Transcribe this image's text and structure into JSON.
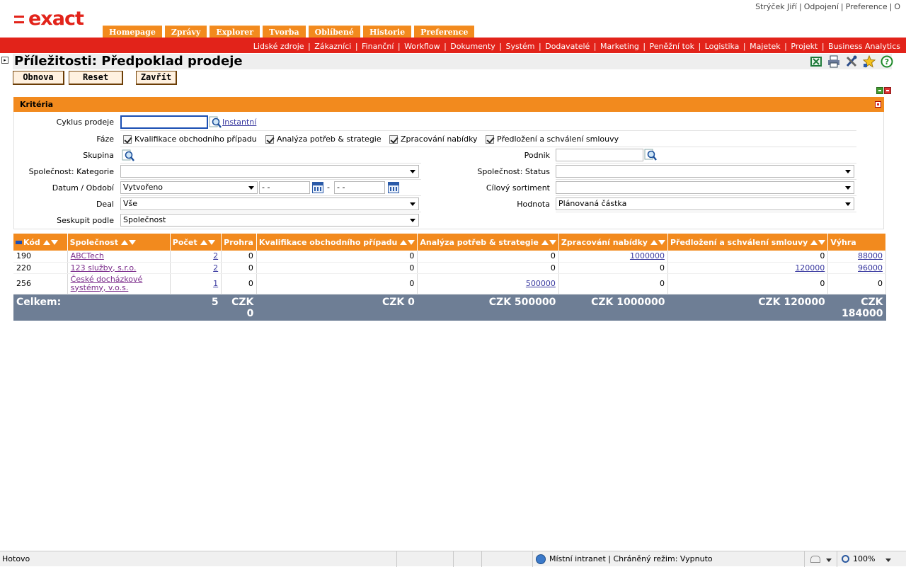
{
  "app": {
    "logo_text": "exact"
  },
  "user_links": [
    "Strýček Jiří",
    "Odpojení",
    "Preference",
    "O"
  ],
  "main_tabs": [
    "Homepage",
    "Zprávy",
    "Explorer",
    "Tvorba",
    "Oblíbené",
    "Historie",
    "Preference"
  ],
  "sub_nav": [
    "Lidské zdroje",
    "Zákazníci",
    "Finanční",
    "Workflow",
    "Dokumenty",
    "Systém",
    "Dodavatelé",
    "Marketing",
    "Peněžní tok",
    "Logistika",
    "Majetek",
    "Projekt",
    "Business Analytics"
  ],
  "page": {
    "title": "Příležitosti: Předpoklad prodeje",
    "collapse_glyph": "▸"
  },
  "toolbar_icons": [
    "excel-export-icon",
    "print-icon",
    "settings-tools-icon",
    "favorite-star-icon",
    "help-icon"
  ],
  "buttons": {
    "refresh": "Obnova",
    "reset": "Reset",
    "close": "Zavřít"
  },
  "criteria": {
    "header": "Kritéria",
    "sales_cycle": {
      "label": "Cyklus prodeje",
      "value": "",
      "link": "Instantní"
    },
    "phase": {
      "label": "Fáze",
      "options": [
        {
          "label": "Kvalifikace obchodního případu",
          "checked": true
        },
        {
          "label": "Analýza potřeb & strategie",
          "checked": true
        },
        {
          "label": "Zpracování nabídky",
          "checked": true
        },
        {
          "label": "Předložení a schválení smlouvy",
          "checked": true
        }
      ]
    },
    "group": {
      "label": "Skupina"
    },
    "company": {
      "label": "Podnik",
      "value": ""
    },
    "company_category": {
      "label": "Společnost: Kategorie",
      "value": ""
    },
    "company_status": {
      "label": "Společnost: Status",
      "value": ""
    },
    "date_period": {
      "label": "Datum / Období",
      "value": "Vytvořeno",
      "from": "- -",
      "dash": "-",
      "to": "- -"
    },
    "target_range": {
      "label": "Cílový sortiment",
      "value": ""
    },
    "deal": {
      "label": "Deal",
      "value": "Vše"
    },
    "value": {
      "label": "Hodnota",
      "value": "Plánovaná částka"
    },
    "group_by": {
      "label": "Seskupit podle",
      "value": "Společnost"
    }
  },
  "table": {
    "columns": [
      "Kód",
      "Společnost",
      "Počet",
      "Prohra",
      "Kvalifikace obchodního případu",
      "Analýza potřeb & strategie",
      "Zpracování nabídky",
      "Předložení a schválení smlouvy",
      "Výhra"
    ],
    "rows": [
      {
        "code": "190",
        "company": "ABCTech",
        "company2": "",
        "count": "2",
        "lost": "0",
        "qual": "0",
        "anal": "0",
        "offer": "1000000",
        "contract": "0",
        "won": "88000"
      },
      {
        "code": "220",
        "company": "123 služby, s.r.o.",
        "company2": "",
        "count": "2",
        "lost": "0",
        "qual": "0",
        "anal": "0",
        "offer": "0",
        "contract": "120000",
        "won": "96000"
      },
      {
        "code": "256",
        "company": "České docházkové",
        "company2": "systémy, v.o.s.",
        "count": "1",
        "lost": "0",
        "qual": "0",
        "anal": "500000",
        "offer": "0",
        "contract": "0",
        "won": "0"
      }
    ],
    "totals": {
      "label": "Celkem:",
      "count": "5",
      "lost_a": "CZK",
      "lost_b": "0",
      "qual": "CZK 0",
      "anal": "CZK 500000",
      "offer": "CZK 1000000",
      "contract": "CZK 120000",
      "won_a": "CZK",
      "won_b": "184000"
    }
  },
  "status_bar": {
    "left": "Hotovo",
    "zone": "Místní intranet | Chráněný režim: Vypnuto",
    "zoom": "100%"
  }
}
